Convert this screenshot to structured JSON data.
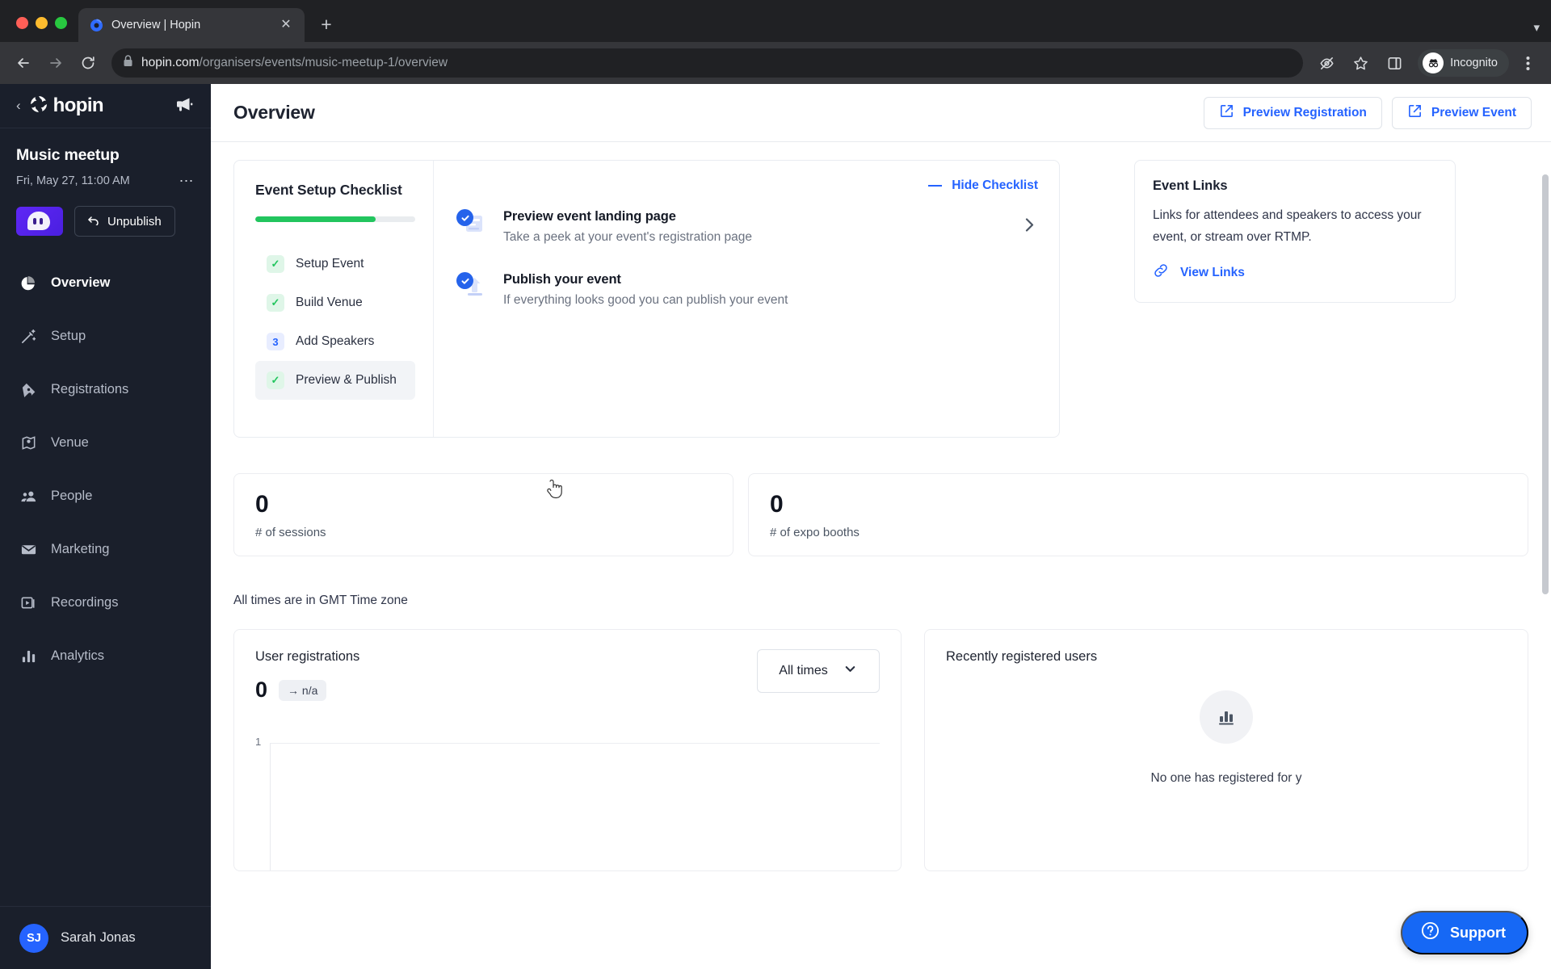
{
  "browser": {
    "tab": {
      "title": "Overview | Hopin",
      "favicon_icon": "hopin-favicon",
      "close_icon": "close-icon"
    },
    "new_tab_icon": "plus-icon",
    "tabstrip_menu_icon": "chevron-down-icon",
    "back_icon": "back-arrow-icon",
    "forward_icon": "forward-arrow-icon",
    "reload_icon": "reload-icon",
    "lock_icon": "lock-icon",
    "url_domain": "hopin.com",
    "url_path": "/organisers/events/music-meetup-1/overview",
    "url_full": "hopin.com/organisers/events/music-meetup-1/overview",
    "toolbar_icons": [
      "eye-slash-icon",
      "star-icon",
      "side-panel-icon"
    ],
    "profile_label": "Incognito",
    "profile_icon": "incognito-icon",
    "menu_icon": "three-dot-menu-icon"
  },
  "sidebar": {
    "back_icon": "chevron-left-icon",
    "brand": "hopin",
    "brand_icon": "hopin-logo-icon",
    "megaphone_icon": "megaphone-icon",
    "event": {
      "name": "Music meetup",
      "date": "Fri, May 27, 11:00 AM",
      "more_icon": "three-dot-menu-icon",
      "avatar_icon": "ghost-avatar-icon",
      "unpublish_label": "Unpublish",
      "unpublish_icon": "undo-arrow-icon"
    },
    "items": [
      {
        "label": "Overview",
        "icon": "pie-chart-icon",
        "active": true
      },
      {
        "label": "Setup",
        "icon": "magic-wand-icon",
        "active": false
      },
      {
        "label": "Registrations",
        "icon": "ticket-icon",
        "active": false
      },
      {
        "label": "Venue",
        "icon": "map-pin-icon",
        "active": false
      },
      {
        "label": "People",
        "icon": "people-icon",
        "active": false
      },
      {
        "label": "Marketing",
        "icon": "envelope-icon",
        "active": false
      },
      {
        "label": "Recordings",
        "icon": "video-play-icon",
        "active": false
      },
      {
        "label": "Analytics",
        "icon": "bar-chart-icon",
        "active": false
      }
    ],
    "user": {
      "initials": "SJ",
      "name": "Sarah Jonas"
    }
  },
  "header": {
    "title": "Overview",
    "preview_registration": "Preview Registration",
    "preview_event": "Preview Event",
    "external_link_icon": "external-link-icon"
  },
  "checklist": {
    "title": "Event Setup Checklist",
    "progress_percent": 75,
    "progress_color": "#22c55e",
    "steps": [
      {
        "label": "Setup Event",
        "badge": "✓",
        "state": "done",
        "current": false
      },
      {
        "label": "Build Venue",
        "badge": "✓",
        "state": "done",
        "current": false
      },
      {
        "label": "Add Speakers",
        "badge": "3",
        "state": "pending",
        "current": false
      },
      {
        "label": "Preview & Publish",
        "badge": "✓",
        "state": "done",
        "current": true
      }
    ],
    "hide_label": "Hide Checklist",
    "hide_icon": "minus-icon",
    "chevron_icon": "chevron-right-icon",
    "tasks": [
      {
        "title": "Preview event landing page",
        "subtitle": "Take a peek at your event's registration page",
        "icon": "landing-page-icon",
        "checked": true,
        "has_chevron": true
      },
      {
        "title": "Publish your event",
        "subtitle": "If everything looks good you can publish your event",
        "icon": "publish-upload-icon",
        "checked": true,
        "has_chevron": false
      }
    ]
  },
  "event_links": {
    "title": "Event Links",
    "description": "Links for attendees and speakers to access your event, or stream over RTMP.",
    "link_label": "View Links",
    "link_icon": "chain-link-icon"
  },
  "stats": [
    {
      "value": "0",
      "label": "# of sessions"
    },
    {
      "value": "0",
      "label": "# of expo booths"
    }
  ],
  "timezone_note": "All times are in GMT Time zone",
  "registrations_chart": {
    "title": "User registrations",
    "kpi_value": "0",
    "kpi_change": "→ n/a",
    "filter_label": "All times",
    "filter_icon": "chevron-down-icon"
  },
  "recent_users": {
    "title": "Recently registered users",
    "empty_icon": "bar-chart-icon",
    "empty_text": "No one has registered for y"
  },
  "support": {
    "label": "Support",
    "icon": "question-circle-icon"
  },
  "chart_data": {
    "type": "line",
    "title": "User registrations",
    "xlabel": "",
    "ylabel": "",
    "x": [],
    "values": [],
    "yticks": [
      "1"
    ],
    "ylim": [
      0,
      1
    ],
    "grid": false,
    "legend": "none",
    "note": "Empty chart — no registration data; only the y-axis tick '1' and axis lines are drawn."
  }
}
